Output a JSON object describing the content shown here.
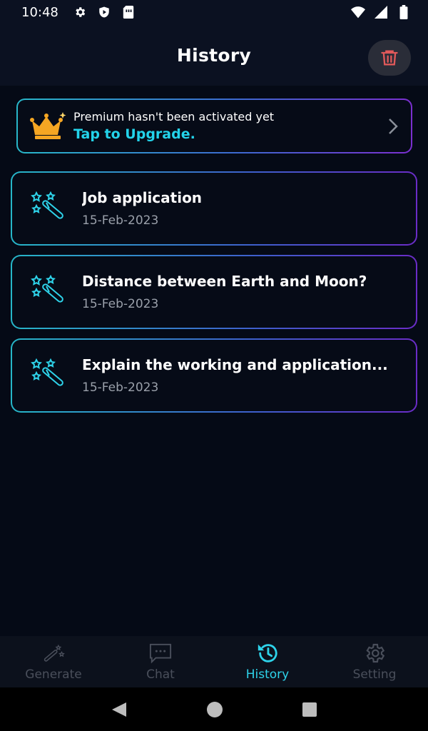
{
  "status_bar": {
    "time": "10:48",
    "icons": [
      "gear-icon",
      "shield-icon",
      "sim-card-icon",
      "wifi-icon",
      "signal-icon",
      "battery-icon"
    ]
  },
  "app_bar": {
    "title": "History",
    "delete_icon": "trash-icon"
  },
  "premium": {
    "note": "Premium hasn't been activated yet",
    "cta": "Tap to Upgrade.",
    "icon": "crown-icon"
  },
  "history": [
    {
      "title": "Job application",
      "date": "15-Feb-2023"
    },
    {
      "title": "Distance between Earth and Moon?",
      "date": "15-Feb-2023"
    },
    {
      "title": "Explain the working and application...",
      "date": "15-Feb-2023"
    }
  ],
  "bottom_nav": [
    {
      "label": "Generate",
      "icon": "magic-wand-icon",
      "active": false
    },
    {
      "label": "Chat",
      "icon": "chat-icon",
      "active": false
    },
    {
      "label": "History",
      "icon": "history-icon",
      "active": true
    },
    {
      "label": "Setting",
      "icon": "gear-icon",
      "active": false
    }
  ],
  "colors": {
    "accent": "#2ed3ea",
    "background": "#050a16",
    "delete": "#e0595a",
    "crown": "#f5a623"
  }
}
